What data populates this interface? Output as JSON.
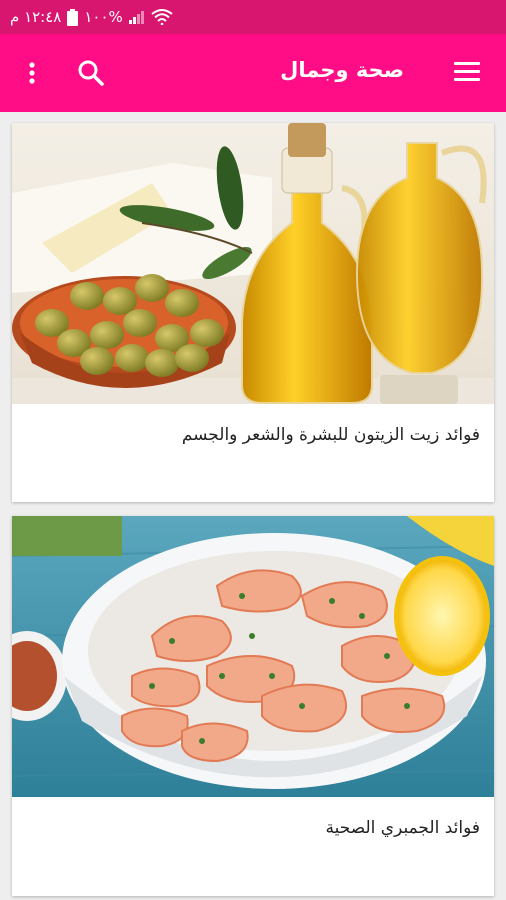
{
  "status_bar": {
    "time": "١٢:٤٨ م",
    "battery": "١٠٠%",
    "colors": {
      "background": "#d8156f"
    }
  },
  "app_bar": {
    "title": "صحة وجمال",
    "background": "#fe0d87",
    "icons": [
      "menu-icon",
      "search-icon",
      "more-vert-icon"
    ]
  },
  "articles": [
    {
      "title": "فوائد زيت الزيتون للبشرة والشعر والجسم",
      "image": "olive-oil-and-olives"
    },
    {
      "title": "فوائد الجمبري الصحية",
      "image": "shrimp-bowl-with-lemon"
    }
  ]
}
